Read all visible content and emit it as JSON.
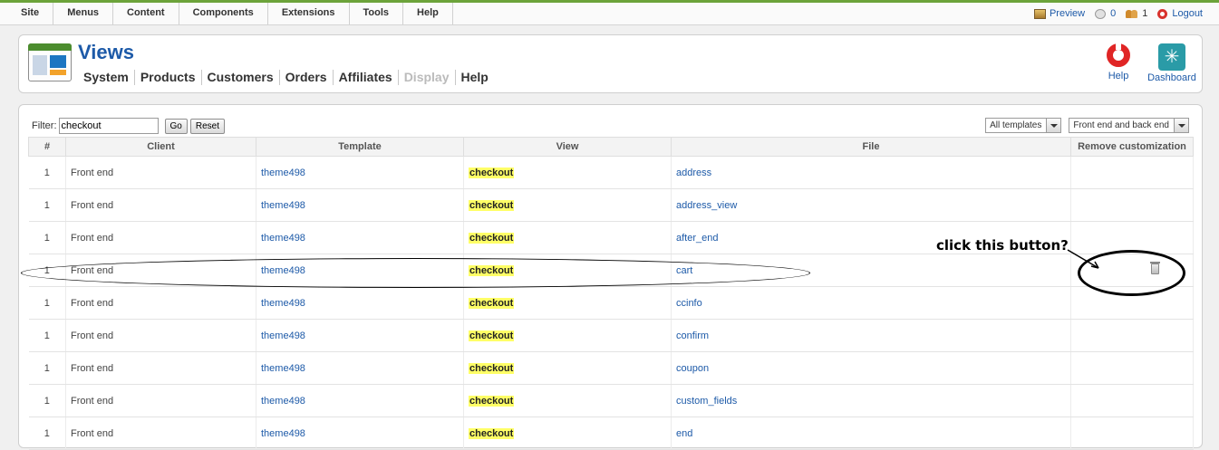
{
  "menu": [
    "Site",
    "Menus",
    "Content",
    "Components",
    "Extensions",
    "Tools",
    "Help"
  ],
  "status": {
    "preview": "Preview",
    "messages": "0",
    "users": "1",
    "logout": "Logout"
  },
  "header": {
    "title": "Views",
    "subnav": [
      "System",
      "Products",
      "Customers",
      "Orders",
      "Affiliates",
      "Display",
      "Help"
    ],
    "disabled_item": "Display",
    "help_label": "Help",
    "dashboard_label": "Dashboard"
  },
  "filter": {
    "label": "Filter:",
    "value": "checkout",
    "go": "Go",
    "reset": "Reset",
    "templates_select": "All templates",
    "client_select": "Front end and back end"
  },
  "table": {
    "columns": [
      "#",
      "Client",
      "Template",
      "View",
      "File",
      "Remove customization"
    ],
    "rows": [
      {
        "num": "1",
        "client": "Front end",
        "template": "theme498",
        "view": "checkout",
        "file": "address",
        "remove": false
      },
      {
        "num": "1",
        "client": "Front end",
        "template": "theme498",
        "view": "checkout",
        "file": "address_view",
        "remove": false
      },
      {
        "num": "1",
        "client": "Front end",
        "template": "theme498",
        "view": "checkout",
        "file": "after_end",
        "remove": false
      },
      {
        "num": "1",
        "client": "Front end",
        "template": "theme498",
        "view": "checkout",
        "file": "cart",
        "remove": true
      },
      {
        "num": "1",
        "client": "Front end",
        "template": "theme498",
        "view": "checkout",
        "file": "ccinfo",
        "remove": false
      },
      {
        "num": "1",
        "client": "Front end",
        "template": "theme498",
        "view": "checkout",
        "file": "confirm",
        "remove": false
      },
      {
        "num": "1",
        "client": "Front end",
        "template": "theme498",
        "view": "checkout",
        "file": "coupon",
        "remove": false
      },
      {
        "num": "1",
        "client": "Front end",
        "template": "theme498",
        "view": "checkout",
        "file": "custom_fields",
        "remove": false
      },
      {
        "num": "1",
        "client": "Front end",
        "template": "theme498",
        "view": "checkout",
        "file": "end",
        "remove": false
      }
    ]
  },
  "annotation": {
    "text": "click this button?"
  },
  "colors": {
    "accent": "#6ca33a",
    "link": "#1d5aa8",
    "highlight": "#ffff66"
  }
}
